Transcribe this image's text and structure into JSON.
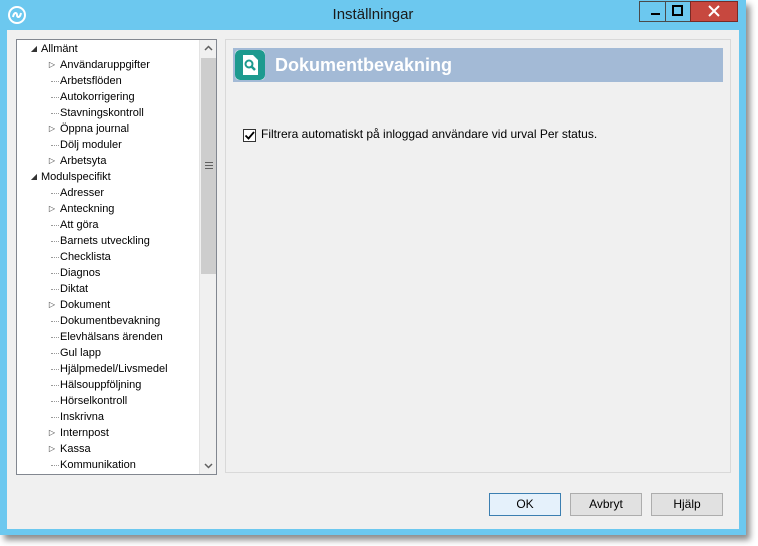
{
  "window": {
    "title": "Inställningar"
  },
  "tree": {
    "items": [
      {
        "label": "Allmänt",
        "level": 0,
        "toggle": "expanded"
      },
      {
        "label": "Användaruppgifter",
        "level": 1,
        "toggle": "collapsed"
      },
      {
        "label": "Arbetsflöden",
        "level": 1,
        "toggle": "none"
      },
      {
        "label": "Autokorrigering",
        "level": 1,
        "toggle": "none"
      },
      {
        "label": "Stavningskontroll",
        "level": 1,
        "toggle": "none"
      },
      {
        "label": "Öppna journal",
        "level": 1,
        "toggle": "collapsed"
      },
      {
        "label": "Dölj moduler",
        "level": 1,
        "toggle": "none"
      },
      {
        "label": "Arbetsyta",
        "level": 1,
        "toggle": "collapsed"
      },
      {
        "label": "Modulspecifikt",
        "level": 0,
        "toggle": "expanded"
      },
      {
        "label": "Adresser",
        "level": 1,
        "toggle": "none"
      },
      {
        "label": "Anteckning",
        "level": 1,
        "toggle": "collapsed"
      },
      {
        "label": "Att göra",
        "level": 1,
        "toggle": "none"
      },
      {
        "label": "Barnets utveckling",
        "level": 1,
        "toggle": "none"
      },
      {
        "label": "Checklista",
        "level": 1,
        "toggle": "none"
      },
      {
        "label": "Diagnos",
        "level": 1,
        "toggle": "none"
      },
      {
        "label": "Diktat",
        "level": 1,
        "toggle": "none"
      },
      {
        "label": "Dokument",
        "level": 1,
        "toggle": "collapsed"
      },
      {
        "label": "Dokumentbevakning",
        "level": 1,
        "toggle": "none"
      },
      {
        "label": "Elevhälsans ärenden",
        "level": 1,
        "toggle": "none"
      },
      {
        "label": "Gul lapp",
        "level": 1,
        "toggle": "none"
      },
      {
        "label": "Hjälpmedel/Livsmedel",
        "level": 1,
        "toggle": "none"
      },
      {
        "label": "Hälsouppföljning",
        "level": 1,
        "toggle": "none"
      },
      {
        "label": "Hörselkontroll",
        "level": 1,
        "toggle": "none"
      },
      {
        "label": "Inskrivna",
        "level": 1,
        "toggle": "none"
      },
      {
        "label": "Internpost",
        "level": 1,
        "toggle": "collapsed"
      },
      {
        "label": "Kassa",
        "level": 1,
        "toggle": "collapsed"
      },
      {
        "label": "Kommunikation",
        "level": 1,
        "toggle": "none"
      }
    ]
  },
  "panel": {
    "title": "Dokumentbevakning",
    "checkbox_label": "Filtrera automatiskt på inloggad användare vid urval Per status.",
    "checkbox_checked": true
  },
  "buttons": {
    "ok": "OK",
    "cancel": "Avbryt",
    "help": "Hjälp"
  },
  "colors": {
    "titlebar": "#6cc8ef",
    "header": "#a3bad6",
    "header_icon": "#1d9a8f",
    "close": "#c7483f"
  }
}
